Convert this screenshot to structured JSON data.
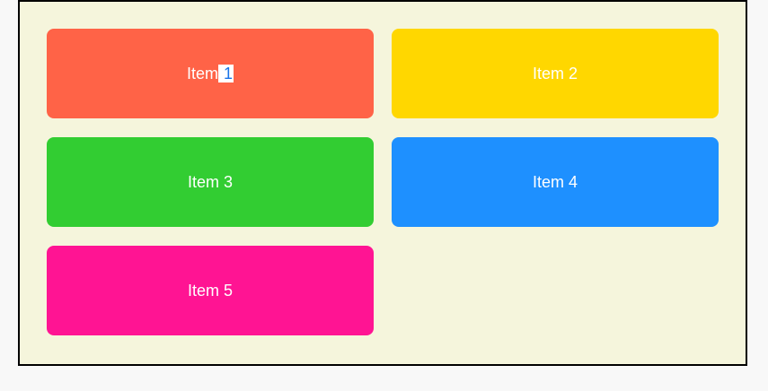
{
  "items": [
    {
      "label_prefix": "Item",
      "label_selected": " 1",
      "color": "#ff6347"
    },
    {
      "label": "Item 2",
      "color": "#ffd700"
    },
    {
      "label": "Item 3",
      "color": "#32cd32"
    },
    {
      "label": "Item 4",
      "color": "#1e90ff"
    },
    {
      "label": "Item 5",
      "color": "#ff1493"
    }
  ]
}
